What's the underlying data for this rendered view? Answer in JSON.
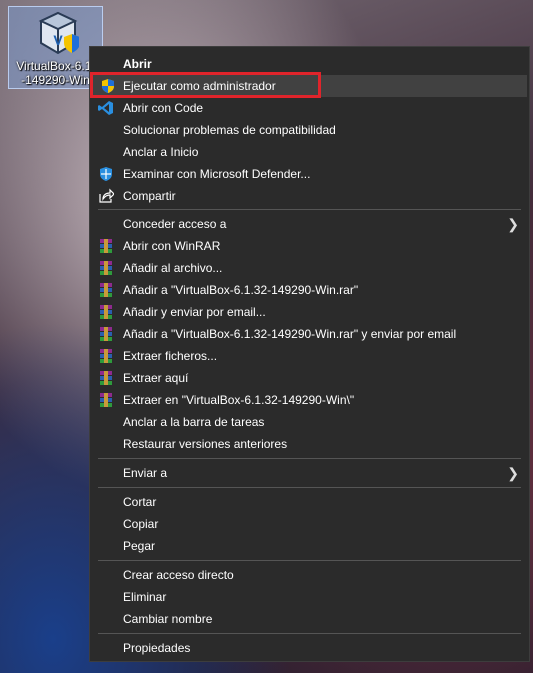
{
  "desktop_icon": {
    "label_line1": "VirtualBox-6.1.",
    "label_line2": "-149290-Win"
  },
  "menu": {
    "items": [
      {
        "label": "Abrir"
      },
      {
        "label": "Ejecutar como administrador"
      },
      {
        "label": "Abrir con Code"
      },
      {
        "label": "Solucionar problemas de compatibilidad"
      },
      {
        "label": "Anclar a Inicio"
      },
      {
        "label": "Examinar con Microsoft Defender..."
      },
      {
        "label": "Compartir"
      },
      {
        "label": "Conceder acceso a"
      },
      {
        "label": "Abrir con WinRAR"
      },
      {
        "label": "Añadir al archivo..."
      },
      {
        "label": "Añadir a \"VirtualBox-6.1.32-149290-Win.rar\""
      },
      {
        "label": "Añadir y enviar por email..."
      },
      {
        "label": "Añadir a \"VirtualBox-6.1.32-149290-Win.rar\" y enviar por email"
      },
      {
        "label": "Extraer ficheros..."
      },
      {
        "label": "Extraer aquí"
      },
      {
        "label": "Extraer en \"VirtualBox-6.1.32-149290-Win\\\""
      },
      {
        "label": "Anclar a la barra de tareas"
      },
      {
        "label": "Restaurar versiones anteriores"
      },
      {
        "label": "Enviar a"
      },
      {
        "label": "Cortar"
      },
      {
        "label": "Copiar"
      },
      {
        "label": "Pegar"
      },
      {
        "label": "Crear acceso directo"
      },
      {
        "label": "Eliminar"
      },
      {
        "label": "Cambiar nombre"
      },
      {
        "label": "Propiedades"
      }
    ]
  },
  "colors": {
    "menu_bg": "#2b2b2b",
    "hover_bg": "#414141",
    "highlight_border": "#e0242b"
  }
}
